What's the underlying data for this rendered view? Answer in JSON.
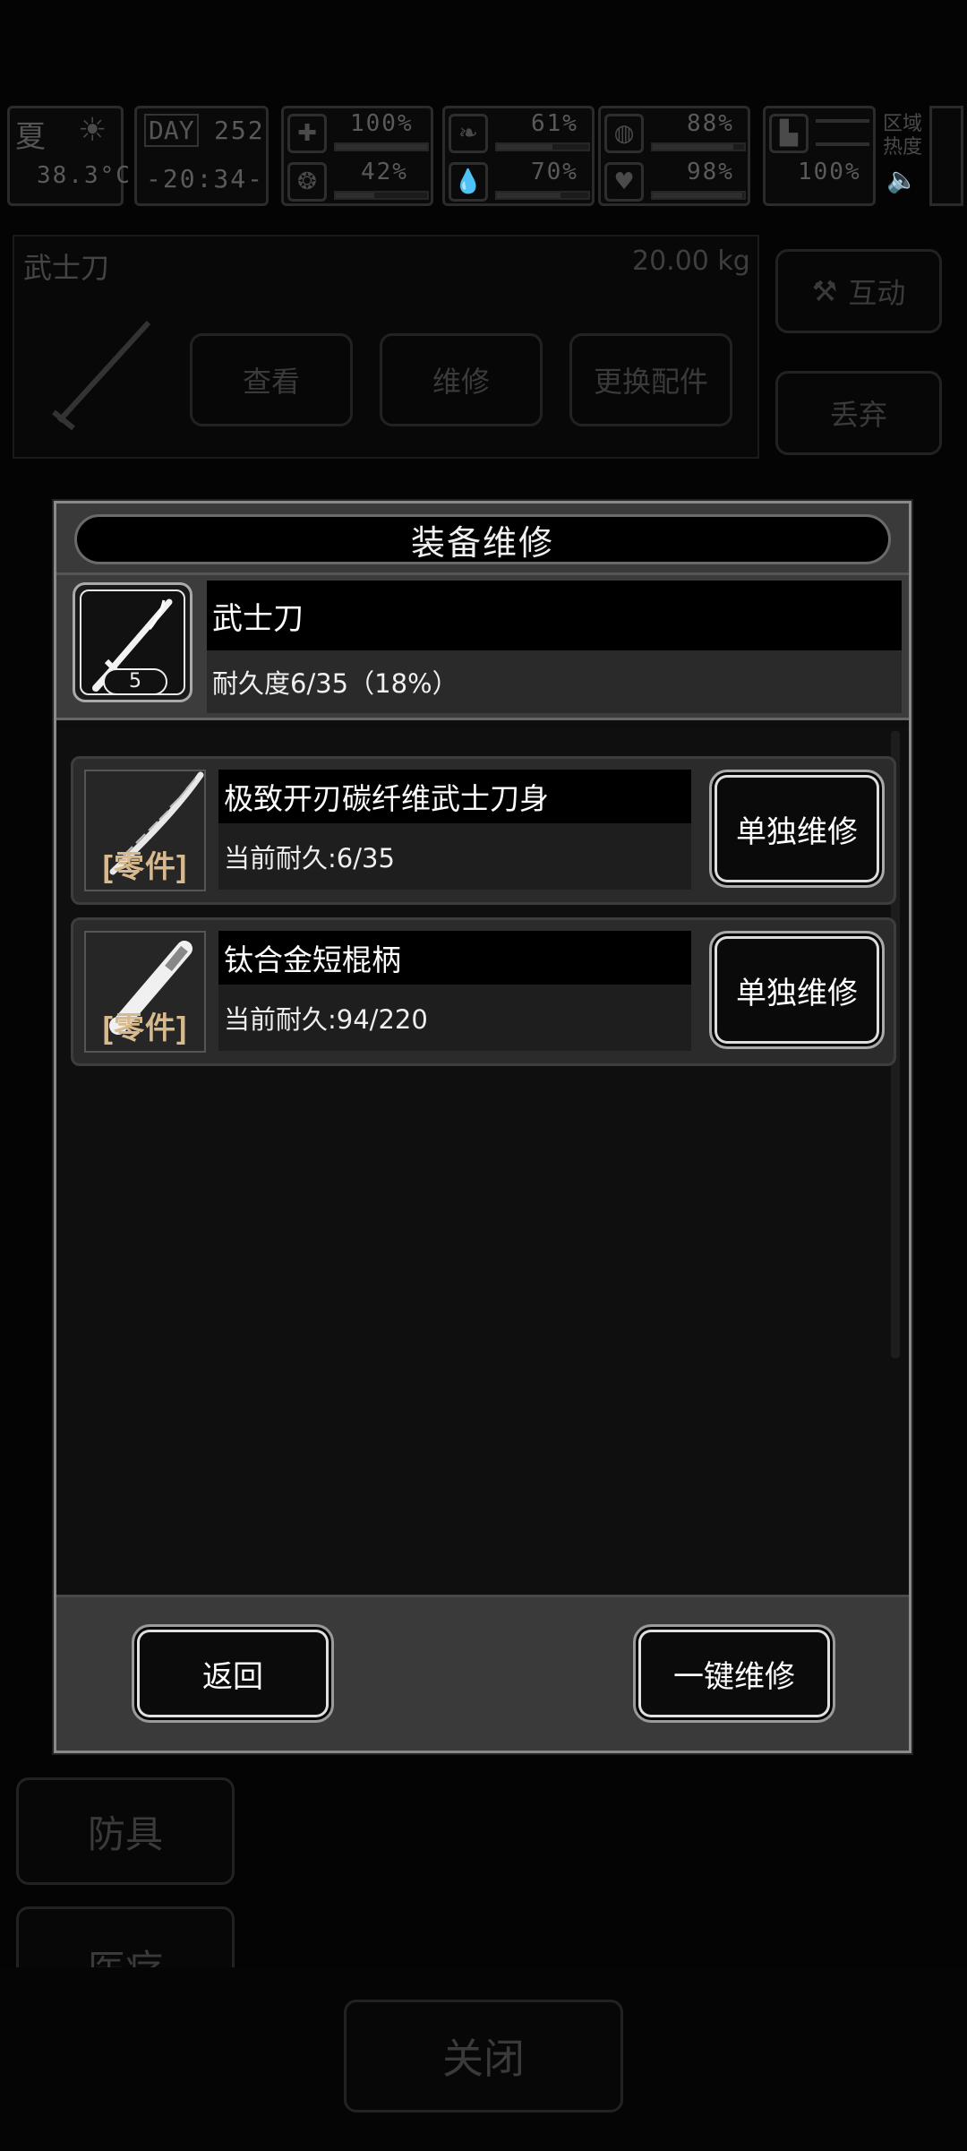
{
  "hud": {
    "season": "夏",
    "temperature": "38.3°C",
    "day_label": "DAY",
    "day_number": "252",
    "time": "-20:34-",
    "stat_health": "100%",
    "stat_stomach": "61%",
    "stat_stamina": "88%",
    "stat_brain": "42%",
    "stat_water": "70%",
    "stat_heart": "98%",
    "stat_misc": "100%",
    "region_heat_label": "区域\n热度"
  },
  "background": {
    "item_title": "武士刀",
    "item_weight": "20.00 kg",
    "buttons": [
      "查看",
      "维修",
      "更换配件"
    ],
    "interact_label": "互动",
    "discard_label": "丢弃",
    "side_tabs": [
      "防具",
      "医疗"
    ],
    "close_label": "关闭"
  },
  "dialog": {
    "title": "装备维修",
    "item": {
      "name": "武士刀",
      "durability": "耐久度6/35（18%）",
      "level": "5"
    },
    "parts": [
      {
        "name": "极致开刃碳纤维武士刀身",
        "durability": "当前耐久:6/35",
        "tag": "零件",
        "button": "单独维修"
      },
      {
        "name": "钛合金短棍柄",
        "durability": "当前耐久:94/220",
        "tag": "零件",
        "button": "单独维修"
      }
    ],
    "back_label": "返回",
    "repair_all_label": "一键维修"
  },
  "colors": {
    "dialog_border": "#8a8a8a",
    "header_bg": "#3a3a3a",
    "tag_color": "#d7b98e"
  }
}
